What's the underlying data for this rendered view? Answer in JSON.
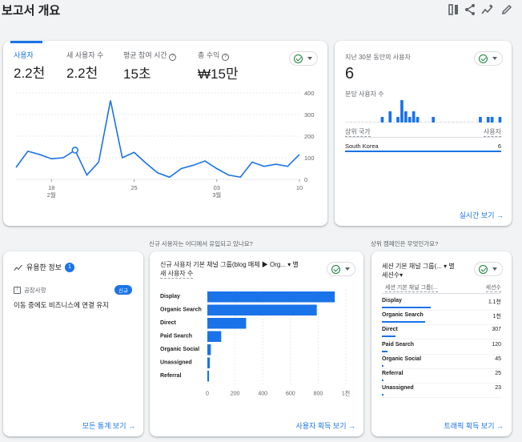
{
  "page": {
    "title": "보고서 개요"
  },
  "metrics": {
    "items": [
      {
        "label": "사용자",
        "value": "2.2천"
      },
      {
        "label": "새 사용자 수",
        "value": "2.2천"
      },
      {
        "label": "평균 참여 시간",
        "value": "15초"
      },
      {
        "label": "총 수익",
        "value": "₩15만"
      }
    ]
  },
  "chart_data": [
    {
      "type": "line",
      "x": [
        "2/15",
        "2/16",
        "2/17",
        "2/18",
        "2/19",
        "2/20",
        "2/21",
        "2/22",
        "2/23",
        "2/24",
        "2/25",
        "2/26",
        "2/27",
        "2/28",
        "3/1",
        "3/2",
        "3/3",
        "3/4",
        "3/5",
        "3/6",
        "3/7",
        "3/8",
        "3/9",
        "3/10",
        "3/11"
      ],
      "series": [
        {
          "values": [
            55,
            130,
            115,
            95,
            100,
            135,
            20,
            80,
            365,
            100,
            125,
            75,
            30,
            10,
            50,
            65,
            85,
            50,
            20,
            10,
            80,
            60,
            70,
            60,
            115
          ]
        }
      ],
      "ylim": [
        0,
        400
      ],
      "y_ticks": [
        "400",
        "300",
        "200",
        "100",
        "0"
      ],
      "x_ticks": [
        {
          "top": "18",
          "bottom": "2월"
        },
        {
          "top": "25",
          "bottom": ""
        },
        {
          "top": "03",
          "bottom": "3월"
        },
        {
          "top": "10",
          "bottom": ""
        }
      ]
    },
    {
      "type": "bar",
      "categories": [
        "Display",
        "Organic Search",
        "Direct",
        "Paid Search",
        "Organic Social",
        "Unassigned",
        "Referral"
      ],
      "values": [
        920,
        790,
        280,
        100,
        25,
        18,
        12
      ],
      "xlim": [
        0,
        1000
      ],
      "x_ticks": [
        "0",
        "200",
        "400",
        "600",
        "800",
        "1천"
      ]
    },
    {
      "type": "bar",
      "values": [
        0,
        0,
        0,
        0,
        0,
        0,
        0,
        0,
        0,
        1,
        0,
        2,
        0,
        1,
        4,
        2,
        1,
        2,
        1,
        0,
        0,
        0,
        1,
        0,
        0,
        0,
        0,
        0,
        0,
        0,
        0,
        0,
        0,
        0,
        1,
        0,
        1,
        1,
        0,
        1
      ]
    }
  ],
  "realtime": {
    "label": "지난 30분 동안의 사용자",
    "value": "6",
    "sub_label": "분당 사용자 수",
    "col_country": "상위 국가",
    "col_users": "사용자",
    "row_country": "South Korea",
    "row_value": "6",
    "link": "실시간 보기"
  },
  "insights": {
    "title": "유용한 정보",
    "badge": "1",
    "section": "공장사항",
    "new_badge": "신규",
    "text": "이동 중에도 비즈니스에 연결 유지",
    "link": "모든 통계 보기"
  },
  "acquisition": {
    "caption": "신규 사용자는 어디에서 유입되고 있나요?",
    "title_line1": "신규 사용자 기본 채널 그룹(blog 매체 ▶ Org... ▾ 별",
    "title_line2": "새 사용자 수",
    "link": "사용자 획득 보기"
  },
  "campaigns": {
    "caption": "상위 캠페인은 무엇인가요?",
    "title_line1": "세션 기본 채널 그룹(... ▾ 별",
    "title_line2": "세션수▾",
    "col1": "세션 기본 채널 그룹(...",
    "col2": "세션수",
    "rows": [
      {
        "name": "Display",
        "value": "1.1천",
        "frac": 0.98
      },
      {
        "name": "Organic Search",
        "value": "1천",
        "frac": 0.87
      },
      {
        "name": "Direct",
        "value": "307",
        "frac": 0.28
      },
      {
        "name": "Paid Search",
        "value": "120",
        "frac": 0.11
      },
      {
        "name": "Organic Social",
        "value": "45",
        "frac": 0.04
      },
      {
        "name": "Referral",
        "value": "25",
        "frac": 0.025
      },
      {
        "name": "Unassigned",
        "value": "23",
        "frac": 0.02
      }
    ],
    "link": "트래픽 획득 보기"
  },
  "colors": {
    "accent": "#1a73e8",
    "bar": "#1a73e8",
    "ok": "#188038"
  },
  "icons": [
    "compare-icon",
    "share-icon",
    "insights-icon",
    "edit-icon",
    "insights-sparkle-icon",
    "notice-icon"
  ]
}
